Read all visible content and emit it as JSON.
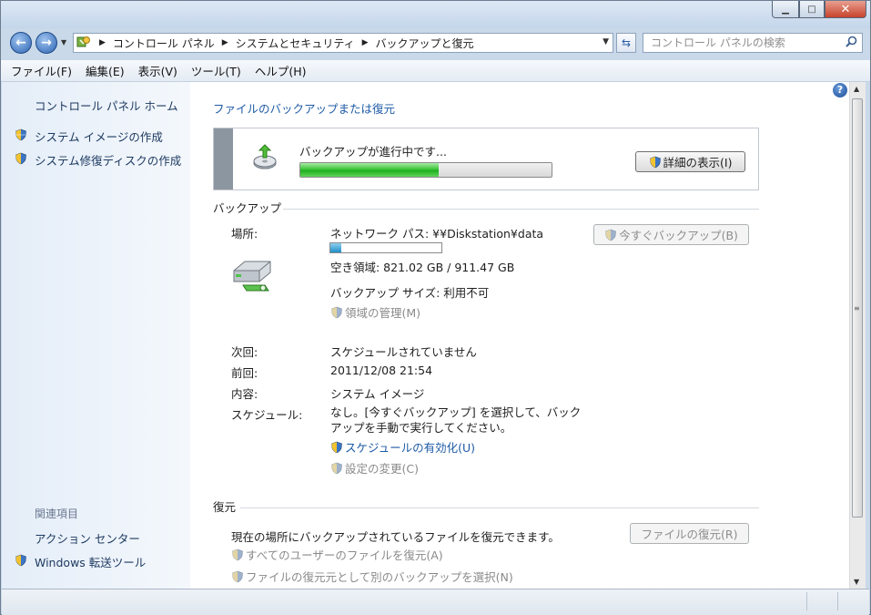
{
  "window": {
    "minimize_glyph": "▁",
    "maximize_glyph": "□",
    "close_glyph": "✕"
  },
  "nav": {
    "back_glyph": "←",
    "forward_glyph": "→",
    "breadcrumbs": [
      "コントロール パネル",
      "システムとセキュリティ",
      "バックアップと復元"
    ],
    "search_placeholder": "コントロール パネルの検索"
  },
  "menu": {
    "items": [
      "ファイル(F)",
      "編集(E)",
      "表示(V)",
      "ツール(T)",
      "ヘルプ(H)"
    ]
  },
  "sidebar": {
    "home": "コントロール パネル ホーム",
    "tasks": [
      "システム イメージの作成",
      "システム修復ディスクの作成"
    ],
    "related_heading": "関連項目",
    "related": [
      "アクション センター",
      "Windows 転送ツール"
    ]
  },
  "main": {
    "title": "ファイルのバックアップまたは復元",
    "progress": {
      "message": "バックアップが進行中です...",
      "fraction": 0.55,
      "details_button": "詳細の表示(I)"
    },
    "backup": {
      "heading": "バックアップ",
      "location_label": "場所:",
      "location_value": "ネットワーク パス: ¥¥Diskstation¥data",
      "space_fraction": 0.1,
      "free_space": "空き領域: 821.02 GB / 911.47 GB",
      "backup_size": "バックアップ サイズ: 利用不可",
      "manage_space_link": "領域の管理(M)",
      "backup_now_button": "今すぐバックアップ(B)",
      "next_label": "次回:",
      "next_value": "スケジュールされていません",
      "last_label": "前回:",
      "last_value": "2011/12/08 21:54",
      "contents_label": "内容:",
      "contents_value": "システム イメージ",
      "schedule_label": "スケジュール:",
      "schedule_value": "なし。[今すぐバックアップ] を選択して、バックアップを手動で実行してください。",
      "enable_schedule_link": "スケジュールの有効化(U)",
      "change_settings_link": "設定の変更(C)"
    },
    "restore": {
      "heading": "復元",
      "description": "現在の場所にバックアップされているファイルを復元できます。",
      "restore_files_button": "ファイルの復元(R)",
      "restore_all_users_link": "すべてのユーザーのファイルを復元(A)",
      "select_other_backup_link": "ファイルの復元元として別のバックアップを選択(N)"
    }
  },
  "colors": {
    "link": "#1d5aa5",
    "disabled": "#8a8a8a",
    "progress_green": "#2fbf2f",
    "space_blue": "#1f8ec9"
  }
}
